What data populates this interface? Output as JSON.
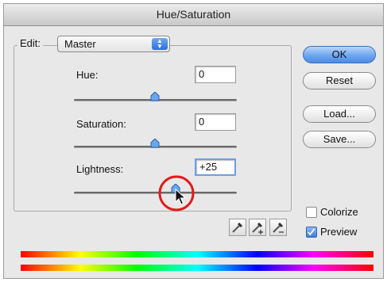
{
  "dialog": {
    "title": "Hue/Saturation"
  },
  "edit": {
    "label": "Edit:",
    "selected": "Master"
  },
  "sliders": {
    "hue": {
      "label": "Hue:",
      "value": "0",
      "position": 0.5
    },
    "saturation": {
      "label": "Saturation:",
      "value": "0",
      "position": 0.5
    },
    "lightness": {
      "label": "Lightness:",
      "value": "+25",
      "position": 0.625
    }
  },
  "buttons": {
    "ok": "OK",
    "reset": "Reset",
    "load": "Load...",
    "save": "Save..."
  },
  "options": {
    "colorize": {
      "label": "Colorize",
      "checked": false
    },
    "preview": {
      "label": "Preview",
      "checked": true
    }
  },
  "icons": {
    "edit_arrows": "up-down-arrows-icon",
    "eyedropper": "eyedropper-icon",
    "eyedropper_add": "eyedropper-plus-icon",
    "eyedropper_subtract": "eyedropper-minus-icon",
    "cursor": "mouse-pointer-icon"
  },
  "colors": {
    "accent": "#4b8be6",
    "highlight_circle": "#e01b1b"
  }
}
